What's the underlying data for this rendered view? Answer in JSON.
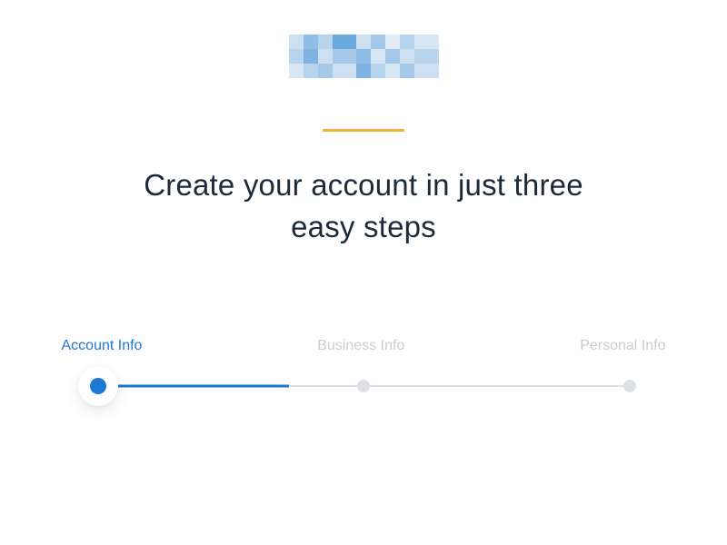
{
  "title": "Create your account in just three easy steps",
  "steps": [
    {
      "label": "Account Info",
      "active": true
    },
    {
      "label": "Business Info",
      "active": false
    },
    {
      "label": "Personal Info",
      "active": false
    }
  ],
  "colors": {
    "accent": "#f2b33d",
    "primary": "#1f77d4",
    "text": "#1b2a3a",
    "muted": "#c9cdd2"
  }
}
